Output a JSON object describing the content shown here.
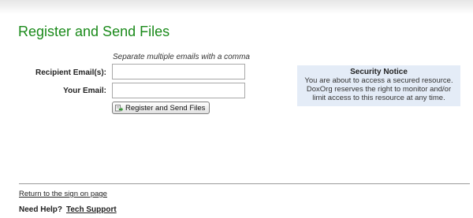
{
  "page": {
    "title": "Register and Send Files"
  },
  "form": {
    "hint": "Separate multiple emails with a comma",
    "recipient_label": "Recipient Email(s):",
    "recipient_value": "",
    "your_email_label": "Your Email:",
    "your_email_value": "",
    "submit_label": "Register and Send Files",
    "submit_icon": "send-file-icon"
  },
  "security_notice": {
    "title": "Security Notice",
    "line1": "You are about to access a secured resource.",
    "line2": "DoxOrg reserves the right to monitor and/or",
    "line3": "limit access to this resource at any time."
  },
  "footer": {
    "return_link": "Return to the sign on page",
    "help_label": "Need Help?",
    "tech_support_link": "Tech Support"
  },
  "colors": {
    "title_green": "#1a8a1a",
    "notice_background": "#e4ecf7"
  }
}
